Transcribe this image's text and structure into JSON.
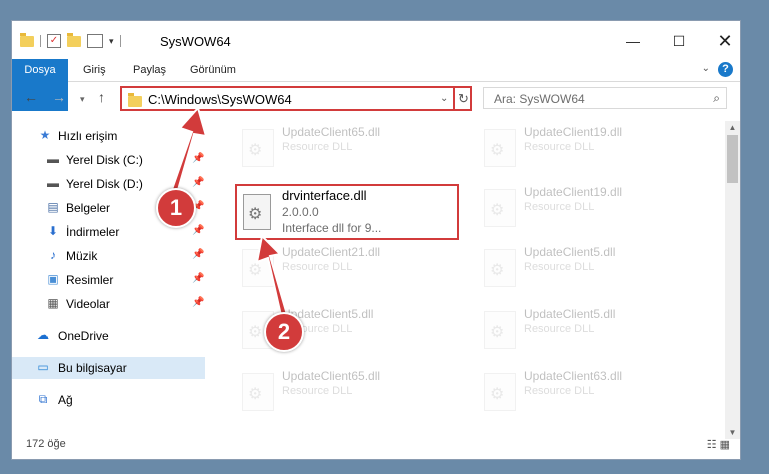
{
  "window": {
    "title": "SysWOW64",
    "controls": {
      "minimize": "—",
      "maximize": "☐",
      "close": "✕"
    }
  },
  "ribbon": {
    "tabs": [
      "Dosya",
      "Giriş",
      "Paylaş",
      "Görünüm"
    ],
    "help": "?"
  },
  "address": {
    "path": "C:\\Windows\\SysWOW64",
    "search_placeholder": "Ara: SysWOW64"
  },
  "sidebar": {
    "items": [
      {
        "label": "Hızlı erişim",
        "icon": "star-icon"
      },
      {
        "label": "Yerel Disk (C:)",
        "icon": "drive-icon"
      },
      {
        "label": "Yerel Disk (D:)",
        "icon": "drive-icon"
      },
      {
        "label": "Belgeler",
        "icon": "documents-icon"
      },
      {
        "label": "İndirmeler",
        "icon": "download-icon"
      },
      {
        "label": "Müzik",
        "icon": "music-icon"
      },
      {
        "label": "Resimler",
        "icon": "pictures-icon"
      },
      {
        "label": "Videolar",
        "icon": "video-icon"
      },
      {
        "label": "OneDrive",
        "icon": "cloud-icon"
      },
      {
        "label": "Bu bilgisayar",
        "icon": "computer-icon"
      },
      {
        "label": "Ağ",
        "icon": "network-icon"
      }
    ]
  },
  "files": {
    "left": [
      {
        "name": "UpdateClient65.dll",
        "type": "Resource DLL"
      },
      {
        "name": "UpdateClient21.dll",
        "type": "Resource DLL"
      },
      {
        "name": "UpdateClient5.dll",
        "type": "Resource DLL"
      },
      {
        "name": "UpdateClient65.dll",
        "type": "Resource DLL"
      }
    ],
    "right": [
      {
        "name": "UpdateClient19.dll",
        "type": "Resource DLL"
      },
      {
        "name": "UpdateClient19.dll",
        "type": "Resource DLL"
      },
      {
        "name": "UpdateClient5.dll",
        "type": "Resource DLL"
      },
      {
        "name": "UpdateClient5.dll",
        "type": "Resource DLL"
      },
      {
        "name": "UpdateClient63.dll",
        "type": "Resource DLL"
      }
    ],
    "highlighted": {
      "name": "drvinterface.dll",
      "version": "2.0.0.0",
      "description": "Interface dll for 9..."
    }
  },
  "status": {
    "count": "172 öğe"
  },
  "annotations": {
    "step1": "1",
    "step2": "2"
  },
  "colors": {
    "accent": "#1979ca",
    "highlight": "#d23b3b"
  }
}
